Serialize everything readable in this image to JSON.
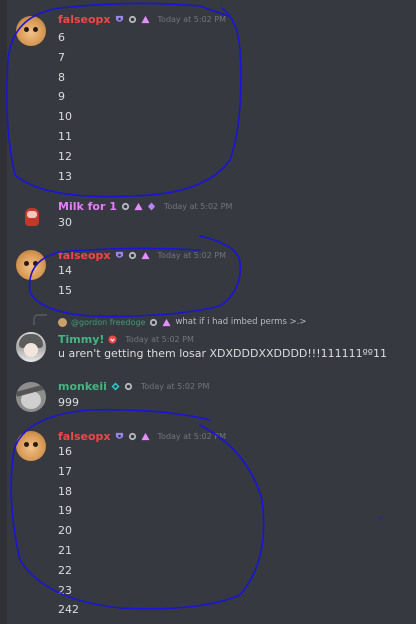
{
  "colors": {
    "background": "#36393f",
    "timestamp": "#72767d",
    "falseopx": "#f04747",
    "milk": "#e77dfa",
    "timmy": "#43b581",
    "monkeii": "#43b581",
    "annotation": "#1b14d8"
  },
  "messages": [
    {
      "username": "falseopx",
      "timestamp": "Today at 5:02 PM",
      "badges": [
        "shield-badge-icon",
        "bot-badge-icon",
        "triangle-badge-icon"
      ],
      "lines": [
        "6",
        "7",
        "8",
        "9",
        "10",
        "11",
        "12",
        "13"
      ]
    },
    {
      "username": "Milk for 1",
      "timestamp": "Today at 5:02 PM",
      "badges": [
        "bot-badge-icon",
        "triangle-badge-icon",
        "diamond-badge-icon"
      ],
      "lines": [
        "30"
      ]
    },
    {
      "username": "falseopx",
      "timestamp": "Today at 5:02 PM",
      "badges": [
        "shield-badge-icon",
        "bot-badge-icon",
        "triangle-badge-icon"
      ],
      "lines": [
        "14",
        "15"
      ]
    },
    {
      "username": "Timmy!",
      "timestamp": "Today at 5:02 PM",
      "badges": [
        "heart-badge-icon"
      ],
      "reply": {
        "name": "@gordon freedoge",
        "text": "what if i had imbed perms >.>"
      },
      "lines": [
        "u aren't getting them losar XDXDDDXXDDDD!!!111111ºº11"
      ]
    },
    {
      "username": "monkeii",
      "timestamp": "Today at 5:02 PM",
      "badges": [
        "diamond-badge-icon",
        "bot-badge-icon"
      ],
      "lines": [
        "999"
      ]
    },
    {
      "username": "falseopx",
      "timestamp": "Today at 5:02 PM",
      "badges": [
        "shield-badge-icon",
        "bot-badge-icon",
        "triangle-badge-icon"
      ],
      "lines": [
        "16",
        "17",
        "18",
        "19",
        "20",
        "21",
        "22",
        "23",
        "242"
      ]
    }
  ]
}
